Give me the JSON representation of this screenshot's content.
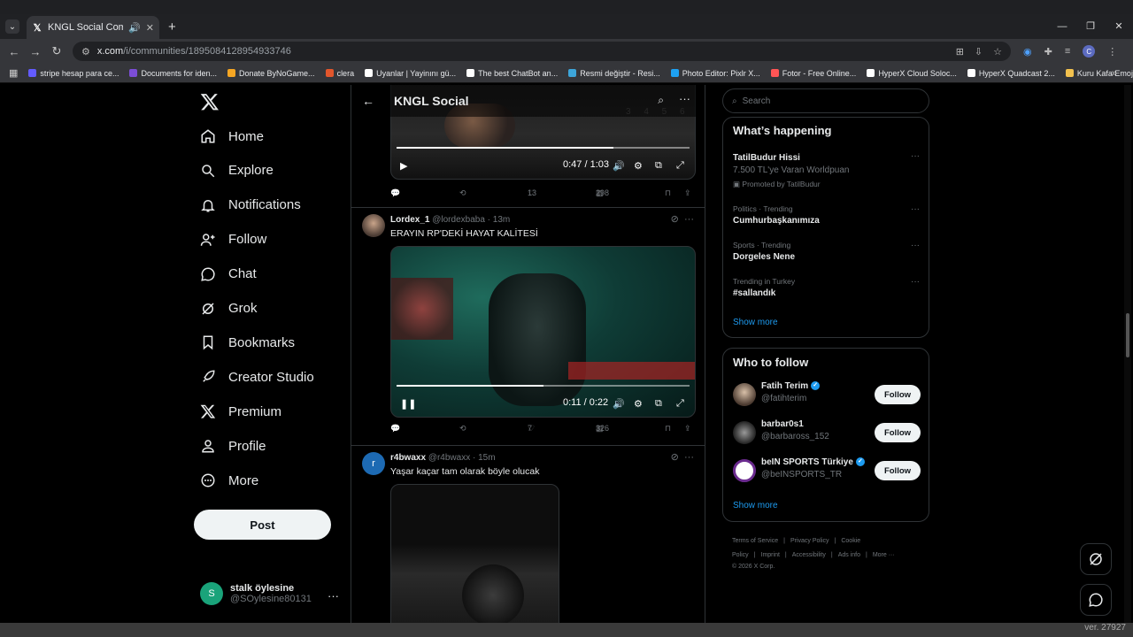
{
  "browser": {
    "tab_title": "KNGL Social Community / X",
    "url_host": "x.com",
    "url_path": "/i/communities/1895084128954933746",
    "profile_initial": "C",
    "bookmarks": [
      {
        "label": "stripe hesap para ce...",
        "color": "#635bff"
      },
      {
        "label": "Documents for iden...",
        "color": "#7b4dd6"
      },
      {
        "label": "Donate ByNoGame...",
        "color": "#f5a623"
      },
      {
        "label": "clera",
        "color": "#e2562c"
      },
      {
        "label": "Uyanlar | Yayinını gü...",
        "color": "#ffffff"
      },
      {
        "label": "The best ChatBot an...",
        "color": "#ffffff"
      },
      {
        "label": "Resmi değiştir - Resi...",
        "color": "#3da5d9"
      },
      {
        "label": "Photo Editor: Pixlr X...",
        "color": "#1da1f2"
      },
      {
        "label": "Fotor - Free Online...",
        "color": "#f55"
      },
      {
        "label": "HyperX Cloud Soloc...",
        "color": "#ffffff"
      },
      {
        "label": "HyperX Quadcast 2...",
        "color": "#ffffff"
      },
      {
        "label": "Kuru Kafa Emojis |...",
        "color": "#f2c14e"
      }
    ]
  },
  "nav": {
    "items": [
      {
        "label": "Home",
        "icon": "home-icon"
      },
      {
        "label": "Explore",
        "icon": "search-icon"
      },
      {
        "label": "Notifications",
        "icon": "bell-icon"
      },
      {
        "label": "Follow",
        "icon": "person-add-icon"
      },
      {
        "label": "Chat",
        "icon": "chat-icon"
      },
      {
        "label": "Grok",
        "icon": "grok-icon"
      },
      {
        "label": "Bookmarks",
        "icon": "bookmark-icon"
      },
      {
        "label": "Creator Studio",
        "icon": "rocket-icon"
      },
      {
        "label": "Premium",
        "icon": "x-logo-icon"
      },
      {
        "label": "Profile",
        "icon": "person-icon"
      },
      {
        "label": "More",
        "icon": "more-circle-icon"
      }
    ],
    "post_label": "Post",
    "user": {
      "initial": "S",
      "name": "stalk öylesine",
      "handle": "@SOylesine80131"
    }
  },
  "feed": {
    "title": "KNGL Social",
    "post1": {
      "time": "0:47 / 1:03",
      "progress": 0.74,
      "replies": "",
      "reposts": "",
      "likes": "13",
      "views": "298"
    },
    "post2": {
      "name": "Lordex_1",
      "handle": "@lordexbaba",
      "age": "· 13m",
      "text": "ERAYIN RP'DEKİ HAYAT KALİTESİ",
      "time": "0:11 / 0:22",
      "progress": 0.5,
      "likes": "7",
      "views": "326"
    },
    "post3": {
      "initial": "r",
      "name": "r4bwaxx",
      "handle": "@r4bwaxx",
      "age": "· 15m",
      "text": "Yaşar kaçar tam olarak böyle olucak"
    }
  },
  "sidebar": {
    "search_placeholder": "Search",
    "happening_title": "What’s happening",
    "trends": [
      {
        "meta": "",
        "title": "TatilBudur Hissi",
        "sub": "7.500 TL'ye Varan Worldpuan",
        "promo": "Promoted by TatilBudur"
      },
      {
        "meta": "Politics · Trending",
        "title": "Cumhurbaşkanımıza"
      },
      {
        "meta": "Sports · Trending",
        "title": "Dorgeles Nene"
      },
      {
        "meta": "Trending in Turkey",
        "title": "#sallandık"
      }
    ],
    "show_more": "Show more",
    "wtf_title": "Who to follow",
    "wtf": [
      {
        "name": "Fatih Terim",
        "handle": "@fatihterim",
        "verified": true
      },
      {
        "name": "barbar0s1",
        "handle": "@barbaross_152",
        "verified": false
      },
      {
        "name": "beIN SPORTS Türkiye",
        "handle": "@beINSPORTS_TR",
        "verified": true
      }
    ],
    "follow_label": "Follow",
    "footer_links": [
      "Terms of Service",
      "|",
      "Privacy Policy",
      "|",
      "Cookie Policy",
      "|",
      "Imprint",
      "|",
      "Accessibility",
      "|",
      "Ads info",
      "|",
      "More ···"
    ],
    "copyright": "© 2026 X Corp."
  },
  "status": {
    "version": "ver. 27927"
  }
}
